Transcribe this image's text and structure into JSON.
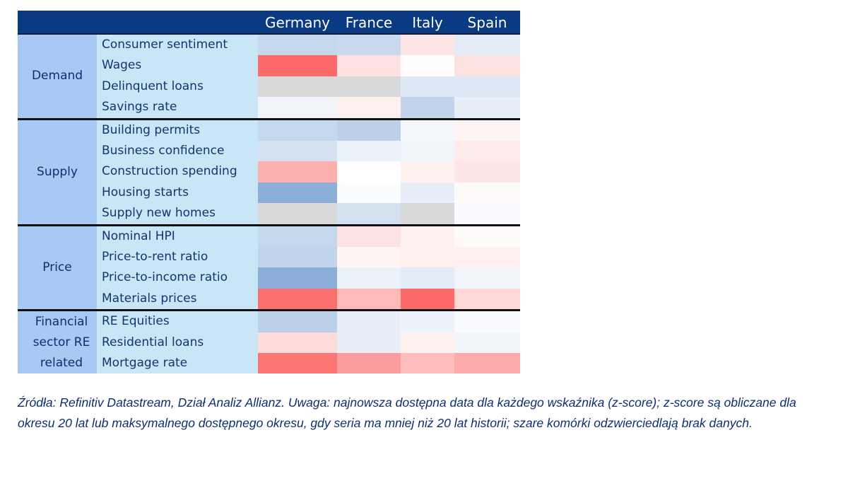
{
  "chart_data": {
    "type": "heatmap",
    "title": "",
    "columns": [
      "Germany",
      "France",
      "Italy",
      "Spain"
    ],
    "value_scale": "z-score (negative = blue, positive = red, null = grey / no data)",
    "groups": [
      {
        "label": "Demand",
        "rows": [
          {
            "label": "Consumer sentiment",
            "values": [
              -1.2,
              -1.1,
              0.5,
              -0.6
            ]
          },
          {
            "label": "Wages",
            "values": [
              3.0,
              0.6,
              0.05,
              0.6
            ]
          },
          {
            "label": "Delinquent loans",
            "values": [
              null,
              null,
              -0.7,
              -0.7
            ]
          },
          {
            "label": "Savings rate",
            "values": [
              -0.3,
              0.3,
              -1.3,
              -0.5
            ]
          }
        ]
      },
      {
        "label": "Supply",
        "rows": [
          {
            "label": "Building permits",
            "values": [
              -1.2,
              -1.4,
              -0.2,
              0.2
            ]
          },
          {
            "label": "Business confidence",
            "values": [
              -0.9,
              -0.4,
              -0.3,
              0.4
            ]
          },
          {
            "label": "Construction spending",
            "values": [
              1.6,
              0.0,
              0.3,
              0.5
            ]
          },
          {
            "label": "Housing starts",
            "values": [
              -2.4,
              -0.1,
              -0.5,
              0.1
            ]
          },
          {
            "label": "Supply new homes",
            "values": [
              null,
              -0.9,
              null,
              -0.15
            ]
          }
        ]
      },
      {
        "label": "Price",
        "rows": [
          {
            "label": "Nominal HPI",
            "values": [
              -1.2,
              0.6,
              0.3,
              0.1
            ]
          },
          {
            "label": "Price-to-rent ratio",
            "values": [
              -1.3,
              0.2,
              0.3,
              0.3
            ]
          },
          {
            "label": "Price-to-income ratio",
            "values": [
              -2.4,
              -0.4,
              -0.6,
              -0.3
            ]
          },
          {
            "label": "Materials prices",
            "values": [
              2.9,
              1.4,
              3.0,
              0.8
            ]
          }
        ]
      },
      {
        "label": "Financial sector RE related",
        "rows": [
          {
            "label": "RE Equities",
            "values": [
              -1.4,
              -0.5,
              -0.4,
              -0.15
            ]
          },
          {
            "label": "Residential loans",
            "values": [
              0.7,
              -0.5,
              0.3,
              -0.3
            ]
          },
          {
            "label": "Mortgage rate",
            "values": [
              2.8,
              2.0,
              1.3,
              1.7
            ]
          }
        ]
      }
    ],
    "colors": {
      "negative": "#6f9bd1",
      "positive": "#fc6a6a",
      "neutral": "#ffffff",
      "missing": "#d9d9d9"
    }
  },
  "caption": "Źródła: Refinitiv Datastream, Dział Analiz Allianz. Uwaga: najnowsza dostępna data dla każdego wskaźnika (z-score); z-score są obliczane dla okresu 20 lat lub maksymalnego dostępnego okresu, gdy seria ma mniej niż 20 lat historii; szare komórki odzwierciedlają brak danych."
}
